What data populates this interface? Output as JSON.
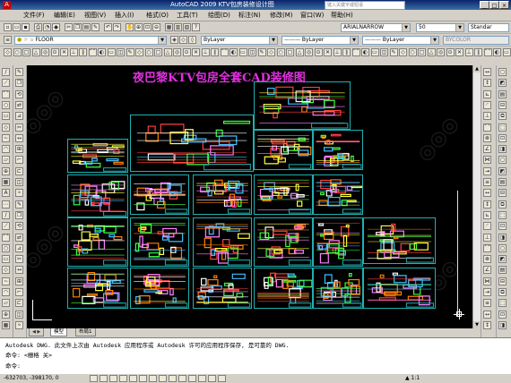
{
  "window": {
    "title": "AutoCAD 2009  KTV包房装修设计图",
    "help_search_placeholder": "键入关键字或短语",
    "min_label": "_",
    "max_label": "□",
    "close_label": "×"
  },
  "menu": [
    "文件(F)",
    "编辑(E)",
    "视图(V)",
    "插入(I)",
    "格式(O)",
    "工具(T)",
    "绘图(D)",
    "标注(N)",
    "修改(M)",
    "窗口(W)",
    "帮助(H)"
  ],
  "toolbars": {
    "layer_name": "FLOOR",
    "color_value": "ByLayer",
    "linetype_value": "ByLayer",
    "lineweight_value": "ByLayer",
    "plotstyle_value": "BYCOLOR",
    "text_style": "ARIALNARROW",
    "text_height": "50",
    "dim_style": "Standar"
  },
  "drawing": {
    "title": "夜巴黎KTV包房全套CAD装修图",
    "title_color": "#e030e0",
    "sheet_border_color": "#20b0b0"
  },
  "tabs": [
    "模型",
    "布局1"
  ],
  "command": {
    "line1": "Autodesk DWG.  此文件上次由 Autodesk 应用程序或 Autodesk 许可的应用程序保存, 是可靠的 DWG.",
    "line2": "命令:  <栅格 关>",
    "line3": "命令:"
  },
  "status": {
    "coordinates": "-632703, -398170, 0",
    "scale": "1:1"
  }
}
